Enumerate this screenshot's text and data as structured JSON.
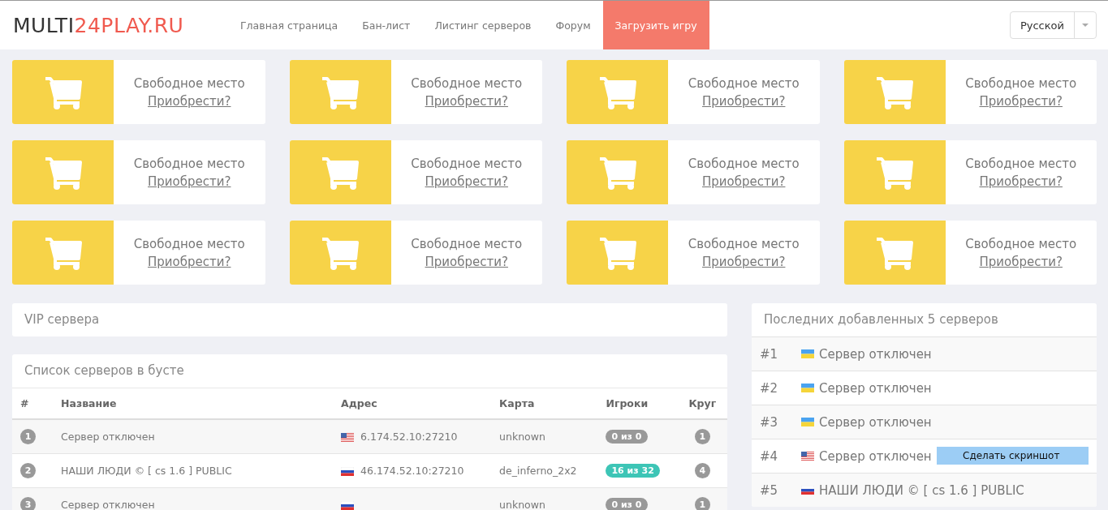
{
  "brand": {
    "dark": "MULTI",
    "accent": "24PLAY.RU"
  },
  "nav": [
    {
      "label": "Главная страница",
      "selected": false
    },
    {
      "label": "Бан-лист",
      "selected": false
    },
    {
      "label": "Листинг серверов",
      "selected": false
    },
    {
      "label": "Форум",
      "selected": false
    },
    {
      "label": "Загрузить игру",
      "selected": true
    }
  ],
  "language": {
    "value": "Русской"
  },
  "slots": [
    {
      "title": "Свободное место",
      "link": "Приобрести?"
    },
    {
      "title": "Свободное место",
      "link": "Приобрести?"
    },
    {
      "title": "Свободное место",
      "link": "Приобрести?"
    },
    {
      "title": "Свободное место",
      "link": "Приобрести?"
    },
    {
      "title": "Свободное место",
      "link": "Приобрести?"
    },
    {
      "title": "Свободное место",
      "link": "Приобрести?"
    },
    {
      "title": "Свободное место",
      "link": "Приобрести?"
    },
    {
      "title": "Свободное место",
      "link": "Приобрести?"
    },
    {
      "title": "Свободное место",
      "link": "Приобрести?"
    },
    {
      "title": "Свободное место",
      "link": "Приобрести?"
    },
    {
      "title": "Свободное место",
      "link": "Приобрести?"
    },
    {
      "title": "Свободное место",
      "link": "Приобрести?"
    }
  ],
  "vip_panel": {
    "title": "VIP сервера"
  },
  "boost_panel": {
    "title": "Список серверов в бусте",
    "columns": [
      "#",
      "Название",
      "Адрес",
      "Карта",
      "Игроки",
      "Круг"
    ],
    "rows": [
      {
        "num": "1",
        "name": "Сервер отключен",
        "flag": {
          "kind": "us"
        },
        "address": "6.174.52.10:27210",
        "map": "unknown",
        "players": "0 из 0",
        "online": false,
        "rounds": "1"
      },
      {
        "num": "2",
        "name": "НАШИ ЛЮДИ © [ cs 1.6 ] PUBLIC",
        "flag": {
          "kind": "ru"
        },
        "address": "46.174.52.10:27210",
        "map": "de_inferno_2x2",
        "players": "16 из 32",
        "online": true,
        "rounds": "4"
      },
      {
        "num": "3",
        "name": "Сервер отключен",
        "flag": {
          "kind": "ru"
        },
        "map": "unknown",
        "players": "0 из 0",
        "online": false,
        "rounds": "1"
      }
    ]
  },
  "latest_panel": {
    "title": "Последних добавленных 5 серверов",
    "rows": [
      {
        "num": "#1",
        "flag": {
          "kind": "ua"
        },
        "name": "Сервер отключен"
      },
      {
        "num": "#2",
        "flag": {
          "kind": "ua"
        },
        "name": "Сервер отключен"
      },
      {
        "num": "#3",
        "flag": {
          "kind": "ua"
        },
        "name": "Сервер отключен"
      },
      {
        "num": "#4",
        "flag": {
          "kind": "us"
        },
        "name": "Сервер отключен"
      },
      {
        "num": "#5",
        "flag": {
          "kind": "ru"
        },
        "name": "НАШИ ЛЮДИ © [ cs 1.6 ] PUBLIC"
      }
    ]
  },
  "screenshot_button": {
    "label": "Сделать скриншот"
  }
}
